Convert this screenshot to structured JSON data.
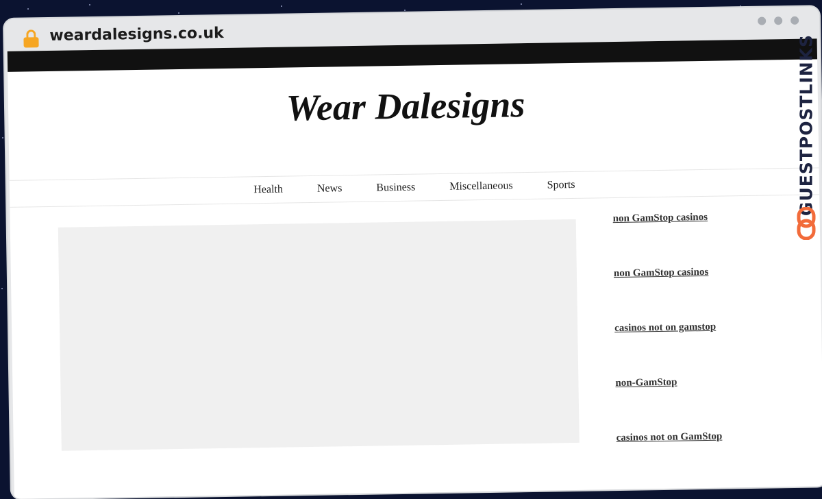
{
  "browser": {
    "url": "weardalesigns.co.uk"
  },
  "site": {
    "title": "Wear Dalesigns"
  },
  "nav": {
    "items": [
      "Health",
      "News",
      "Business",
      "Miscellaneous",
      "Sports"
    ]
  },
  "sidebar": {
    "links": [
      "non GamStop casinos",
      "non GamStop casinos",
      "casinos not on gamstop",
      "non-GamStop",
      "casinos not on GamStop"
    ]
  },
  "watermark": {
    "text": "GUESTPOSTLINKS",
    "colors": {
      "text": "#1d2340",
      "accent": "#f26b3a"
    }
  },
  "colors": {
    "lock": "#f6a623",
    "topbar": "#111111",
    "window_chrome": "#e6e7e9"
  },
  "icons": [
    "lock-icon",
    "link-chain-icon"
  ]
}
